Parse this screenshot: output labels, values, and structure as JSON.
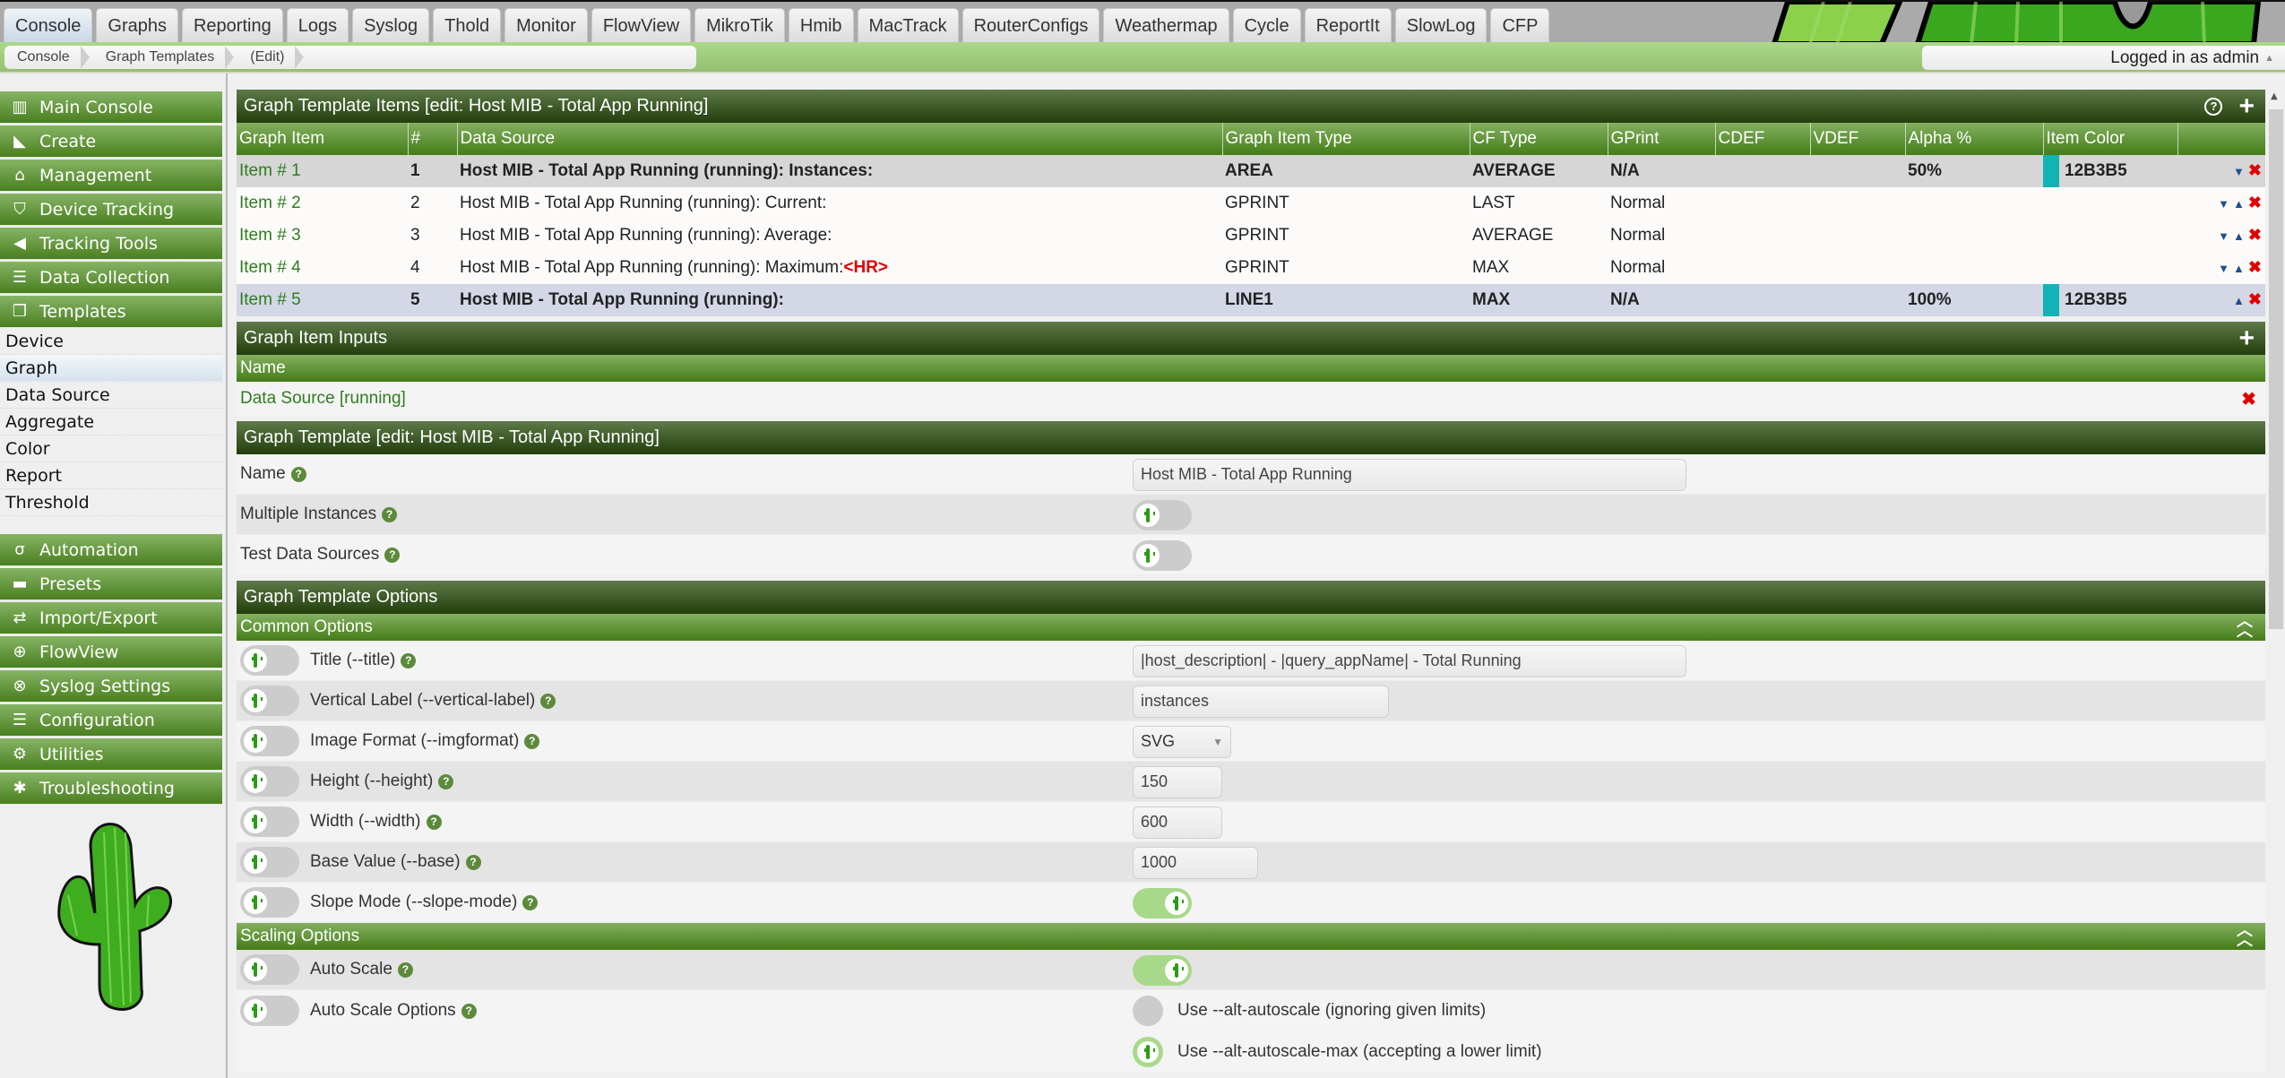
{
  "tabs": [
    {
      "label": "Console",
      "active": true
    },
    {
      "label": "Graphs"
    },
    {
      "label": "Reporting"
    },
    {
      "label": "Logs"
    },
    {
      "label": "Syslog"
    },
    {
      "label": "Thold"
    },
    {
      "label": "Monitor"
    },
    {
      "label": "FlowView"
    },
    {
      "label": "MikroTik"
    },
    {
      "label": "Hmib"
    },
    {
      "label": "MacTrack"
    },
    {
      "label": "RouterConfigs"
    },
    {
      "label": "Weathermap"
    },
    {
      "label": "Cycle"
    },
    {
      "label": "ReportIt"
    },
    {
      "label": "SlowLog"
    },
    {
      "label": "CFP"
    }
  ],
  "breadcrumb": [
    "Console",
    "Graph Templates",
    "(Edit)"
  ],
  "user": {
    "label": "Logged in as admin"
  },
  "sidebar": {
    "menus": [
      {
        "label": "Main Console",
        "icon": "map-icon"
      },
      {
        "label": "Create",
        "icon": "chart-area-icon"
      },
      {
        "label": "Management",
        "icon": "home-icon"
      },
      {
        "label": "Device Tracking",
        "icon": "shield-icon"
      },
      {
        "label": "Tracking Tools",
        "icon": "bullhorn-icon"
      },
      {
        "label": "Data Collection",
        "icon": "database-icon"
      },
      {
        "label": "Templates",
        "icon": "clone-icon"
      }
    ],
    "template_items": [
      "Device",
      "Graph",
      "Data Source",
      "Aggregate",
      "Color",
      "Report",
      "Threshold"
    ],
    "selected_template_item": "Graph",
    "menus_after": [
      {
        "label": "Automation",
        "icon": "automation-icon"
      },
      {
        "label": "Presets",
        "icon": "archive-icon"
      },
      {
        "label": "Import/Export",
        "icon": "exchange-icon"
      },
      {
        "label": "FlowView",
        "icon": "crosshairs-icon"
      },
      {
        "label": "Syslog Settings",
        "icon": "life-ring-icon"
      },
      {
        "label": "Configuration",
        "icon": "sliders-icon"
      },
      {
        "label": "Utilities",
        "icon": "cogs-icon"
      },
      {
        "label": "Troubleshooting",
        "icon": "bug-icon"
      }
    ]
  },
  "items_panel": {
    "title": "Graph Template Items [edit: Host MIB - Total App Running]",
    "columns": [
      "Graph Item",
      "#",
      "Data Source",
      "Graph Item Type",
      "CF Type",
      "GPrint",
      "CDEF",
      "VDEF",
      "Alpha %",
      "Item Color"
    ],
    "rows": [
      {
        "item": "Item # 1",
        "num": "1",
        "data_source": "Host MIB - Total App Running (running): Instances:",
        "hr": "",
        "type": "AREA",
        "cf": "AVERAGE",
        "gprint": "N/A",
        "cdef": "",
        "vdef": "",
        "alpha": "50%",
        "color": "12B3B5",
        "color_hex": "#12B3B5",
        "down": true,
        "up": false
      },
      {
        "item": "Item # 2",
        "num": "2",
        "data_source": "Host MIB - Total App Running (running): Current:",
        "hr": "",
        "type": "GPRINT",
        "cf": "LAST",
        "gprint": "Normal",
        "cdef": "",
        "vdef": "",
        "alpha": "",
        "color": "",
        "color_hex": "",
        "down": true,
        "up": true
      },
      {
        "item": "Item # 3",
        "num": "3",
        "data_source": "Host MIB - Total App Running (running): Average:",
        "hr": "",
        "type": "GPRINT",
        "cf": "AVERAGE",
        "gprint": "Normal",
        "cdef": "",
        "vdef": "",
        "alpha": "",
        "color": "",
        "color_hex": "",
        "down": true,
        "up": true
      },
      {
        "item": "Item # 4",
        "num": "4",
        "data_source": "Host MIB - Total App Running (running): Maximum:",
        "hr": "<HR>",
        "type": "GPRINT",
        "cf": "MAX",
        "gprint": "Normal",
        "cdef": "",
        "vdef": "",
        "alpha": "",
        "color": "",
        "color_hex": "",
        "down": true,
        "up": true
      },
      {
        "item": "Item # 5",
        "num": "5",
        "data_source": "Host MIB - Total App Running (running):",
        "hr": "",
        "type": "LINE1",
        "cf": "MAX",
        "gprint": "N/A",
        "cdef": "",
        "vdef": "",
        "alpha": "100%",
        "color": "12B3B5",
        "color_hex": "#12B3B5",
        "down": false,
        "up": true
      }
    ]
  },
  "inputs_panel": {
    "title": "Graph Item Inputs",
    "column": "Name",
    "rows": [
      "Data Source [running]"
    ]
  },
  "template_panel": {
    "title": "Graph Template [edit: Host MIB - Total App Running]",
    "name_label": "Name",
    "name_value": "Host MIB - Total App Running",
    "multiple_instances_label": "Multiple Instances",
    "multiple_instances_on": false,
    "test_ds_label": "Test Data Sources",
    "test_ds_on": false
  },
  "options_panel": {
    "title": "Graph Template Options",
    "common_title": "Common Options",
    "common": [
      {
        "label": "Title (--title)",
        "type": "text",
        "value": "|host_description| - |query_appName| - Total Running"
      },
      {
        "label": "Vertical Label (--vertical-label)",
        "type": "text",
        "value": "instances"
      },
      {
        "label": "Image Format (--imgformat)",
        "type": "select",
        "value": "SVG"
      },
      {
        "label": "Height (--height)",
        "type": "text",
        "value": "150"
      },
      {
        "label": "Width (--width)",
        "type": "text",
        "value": "600"
      },
      {
        "label": "Base Value (--base)",
        "type": "text",
        "value": "1000"
      },
      {
        "label": "Slope Mode (--slope-mode)",
        "type": "toggle",
        "value": "on"
      }
    ],
    "scaling_title": "Scaling Options",
    "auto_scale_label": "Auto Scale",
    "auto_scale_on": true,
    "auto_scale_options_label": "Auto Scale Options",
    "auto_scale_options": [
      {
        "label": "Use --alt-autoscale (ignoring given limits)",
        "selected": false
      },
      {
        "label": "Use --alt-autoscale-max (accepting a lower limit)",
        "selected": true
      }
    ]
  },
  "colors": {
    "accent_green": "#4a7f1f",
    "dark_green": "#223e0c",
    "delete_red": "#e00000",
    "link_green": "#2f7d1f"
  }
}
